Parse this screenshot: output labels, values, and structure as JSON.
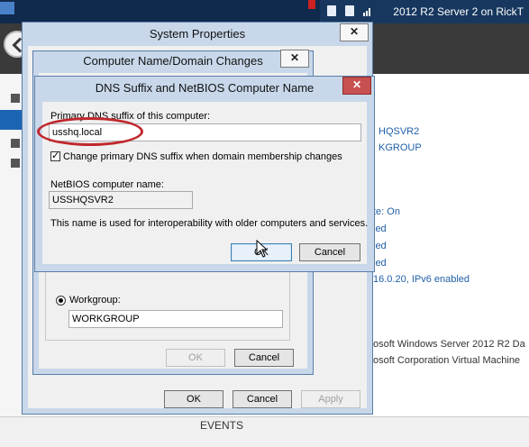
{
  "topbar": {
    "connection_title": "2012 R2 Server 2 on RickT",
    "icons": [
      "pin-icon",
      "connection-icon",
      "signal-icon"
    ]
  },
  "background": {
    "server_values": [
      "HQSVR2",
      "KGROUP"
    ],
    "status_values": [
      "te: On",
      "led",
      "led",
      "led",
      "16.0.20, IPv6 enabled"
    ],
    "os_info": [
      "osoft Windows Server 2012 R2 Da",
      "osoft Corporation Virtual Machine"
    ],
    "events_heading": "EVENTS"
  },
  "system_properties": {
    "title": "System Properties",
    "close": "✕",
    "ok_label": "OK",
    "cancel_label": "Cancel",
    "apply_label": "Apply"
  },
  "computer_name_dialog": {
    "title": "Computer Name/Domain Changes",
    "close": "✕",
    "workgroup_label": "Workgroup:",
    "workgroup_value": "WORKGROUP",
    "ok_label": "OK",
    "cancel_label": "Cancel"
  },
  "dns_dialog": {
    "title": "DNS Suffix and NetBIOS Computer Name",
    "close": "✕",
    "primary_dns_label": "Primary DNS suffix of this computer:",
    "primary_dns_value": "usshq.local",
    "change_checkbox_label": "Change primary DNS suffix when domain membership changes",
    "change_checkbox_checked": true,
    "netbios_label": "NetBIOS computer name:",
    "netbios_value": "USSHQSVR2",
    "info_text": "This name is used for interoperability with older computers and services.",
    "ok_label": "OK",
    "cancel_label": "Cancel"
  },
  "colors": {
    "annotation": "#c0282d",
    "close_button_active": "#c75050",
    "link_blue": "#1f5fa8"
  }
}
